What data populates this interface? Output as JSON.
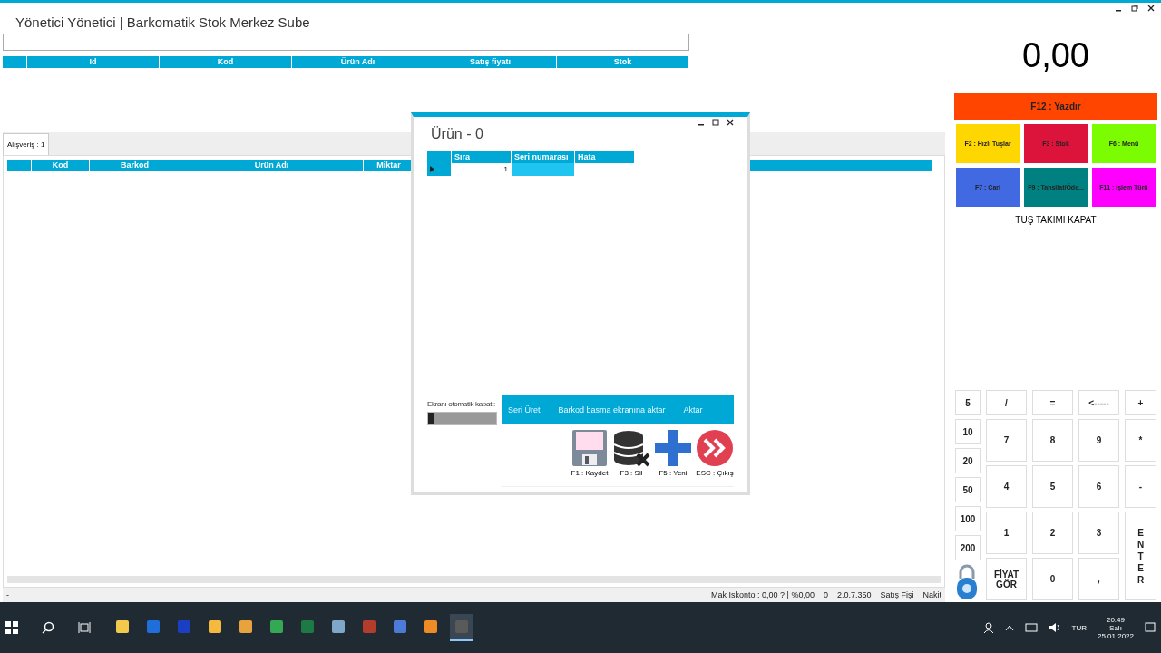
{
  "window": {
    "title": "Yönetici Yönetici | Barkomatik Stok Merkez Sube"
  },
  "product_table": {
    "columns": [
      "Id",
      "Kod",
      "Ürün Adı",
      "Satış fiyatı",
      "Stok"
    ]
  },
  "tabs": [
    {
      "label": "Alışveriş : 1",
      "selected": true
    }
  ],
  "cart_table": {
    "columns": [
      "Kod",
      "Barkod",
      "Ürün Adı",
      "Miktar"
    ]
  },
  "status_bar": {
    "left": "-",
    "items": [
      "Mak Iskonto : 0,00 ? | %0,00",
      "0",
      "2.0.7.350",
      "Satış Fişi",
      "Nakit"
    ]
  },
  "total": "0,00",
  "print_button": {
    "label": "F12 : Yazdır",
    "color": "#ff4500"
  },
  "function_keys": [
    {
      "label": "F2 : Hızlı Tuşlar",
      "color": "#ffd700"
    },
    {
      "label": "F3 : Stok",
      "color": "#dc143c"
    },
    {
      "label": "F6 : Menü",
      "color": "#7cfc00"
    },
    {
      "label": "F7 : Cari",
      "color": "#4169e1"
    },
    {
      "label": "F9 : Tahsilat/Öde...",
      "color": "#008080"
    },
    {
      "label": "F11 : İşlem Türü",
      "color": "#ff00ff"
    }
  ],
  "keyboard_toggle": "TUŞ TAKIMI KAPAT",
  "money_keys": [
    "5",
    "10",
    "20",
    "50",
    "100",
    "200"
  ],
  "keypad": {
    "top": [
      "/",
      "=",
      "<-----",
      "+"
    ],
    "rows": [
      [
        "7",
        "8",
        "9",
        "*"
      ],
      [
        "4",
        "5",
        "6",
        "-"
      ],
      [
        "1",
        "2",
        "3"
      ],
      [
        "FİYAT GÖR",
        "0",
        ","
      ]
    ],
    "enter": "ENTER"
  },
  "dialog": {
    "title": "Ürün - 0",
    "columns": [
      "Sıra",
      "Seri numarası",
      "Hata"
    ],
    "rows": [
      {
        "sira": "1",
        "selected": true
      }
    ],
    "auto_close": {
      "label": "Ekranı otomatik kapat :",
      "on": false
    },
    "actions": [
      "Seri Üret",
      "Barkod basma ekranına aktar",
      "Aktar"
    ],
    "buttons": [
      {
        "kind": "save",
        "label": "F1 : Kaydet"
      },
      {
        "kind": "delete",
        "label": "F3 : Sil"
      },
      {
        "kind": "new",
        "label": "F5 : Yeni"
      },
      {
        "kind": "exit",
        "label": "ESC : Çıkış"
      }
    ]
  },
  "taskbar": {
    "apps": [
      {
        "color": "#f2c94c",
        "selected": false
      },
      {
        "color": "#1e6fd9",
        "selected": false
      },
      {
        "color": "#1a3fc4",
        "selected": false
      },
      {
        "color": "#f5b940",
        "selected": false
      },
      {
        "color": "#e8a33d",
        "selected": false
      },
      {
        "color": "#34a853",
        "selected": false
      },
      {
        "color": "#1d7a45",
        "selected": false
      },
      {
        "color": "#7fa7c9",
        "selected": false
      },
      {
        "color": "#b43c2c",
        "selected": false
      },
      {
        "color": "#4b7bd6",
        "selected": false
      },
      {
        "color": "#f08a24",
        "selected": false
      },
      {
        "color": "#5a5a5a",
        "selected": true
      }
    ],
    "lang": "TUR",
    "time": "20:49",
    "day": "Salı",
    "date": "25.01.2022"
  }
}
